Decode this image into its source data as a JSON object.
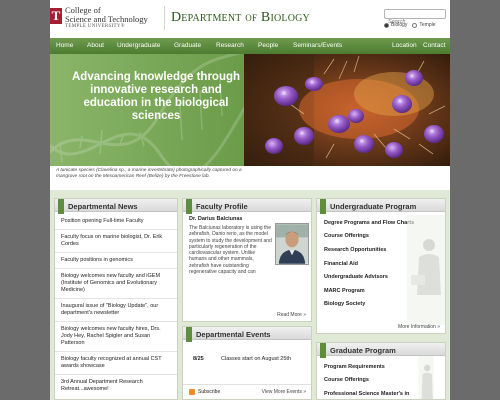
{
  "header": {
    "college_line1": "College of",
    "college_line2": "Science and Technology",
    "university": "TEMPLE UNIVERSITY®",
    "logo_letter": "T",
    "dept_word1": "Department",
    "dept_of": "of",
    "dept_word2": "Biology",
    "search_placeholder": "Search",
    "search_option_1": "Biology",
    "search_option_2": "Temple"
  },
  "nav": {
    "items": [
      "Home",
      "About",
      "Undergraduate",
      "Graduate",
      "Research",
      "People",
      "Seminars/Events",
      "Location",
      "Contact"
    ]
  },
  "hero": {
    "tagline": "Advancing knowledge through innovative research and education in the biological sciences",
    "caption": "A tunicate species (Clavelina sp., a marine invertebrate) photographically captured on a mangrove root on the Mesoamerican Reef (Belize) by the Freestone lab."
  },
  "news": {
    "title": "Departmental News",
    "items": [
      "Position opening Full-time Faculty",
      "Faculty focus on marine biologist, Dr. Erik Cordes",
      "Faculty positions in genomics",
      "Biology welcomes new faculty and iGEM (Institute of Genomics and Evolutionary Medicine)",
      "Inaugural issue of \"Biology Update\", our department's newsletter",
      "Biology welcomes new faculty hires, Drs. Jody Hey, Rachel Spigler and Susan Patterson",
      "Biology faculty recognized at annual CST awards showcase",
      "3rd Annual Department Research Retreat...awesome!"
    ]
  },
  "profile": {
    "title": "Faculty Profile",
    "name": "Dr. Darius Balciunas",
    "text": "The Balciunas laboratory is using the zebrafish, Danio rerio, as the model system to study the development and particularly regeneration of the cardiovascular system.  Unlike humans and other mammals, zebrafish have outstanding regenerative capacity and can",
    "more": "Read More »"
  },
  "events": {
    "title": "Departmental Events",
    "items": [
      {
        "date": "8/25",
        "text": "Classes start on August 25th"
      }
    ],
    "subscribe": "Subscribe",
    "more": "View More Events »"
  },
  "undergrad": {
    "title": "Undergraduate Program",
    "items": [
      "Degree Programs and Flow Charts",
      "Course Offerings",
      "Research Opportunities",
      "Financial Aid",
      "Undergraduate Advisors",
      "MARC Program",
      "Biology Society"
    ],
    "more": "More Information »"
  },
  "graduate": {
    "title": "Graduate Program",
    "items": [
      "Program Requirements",
      "Course Offerings",
      "Professional Science Master's in"
    ]
  },
  "colors": {
    "brand_green": "#4d7b30",
    "temple_red": "#a41e34",
    "page_background": "#6b6b6b"
  }
}
